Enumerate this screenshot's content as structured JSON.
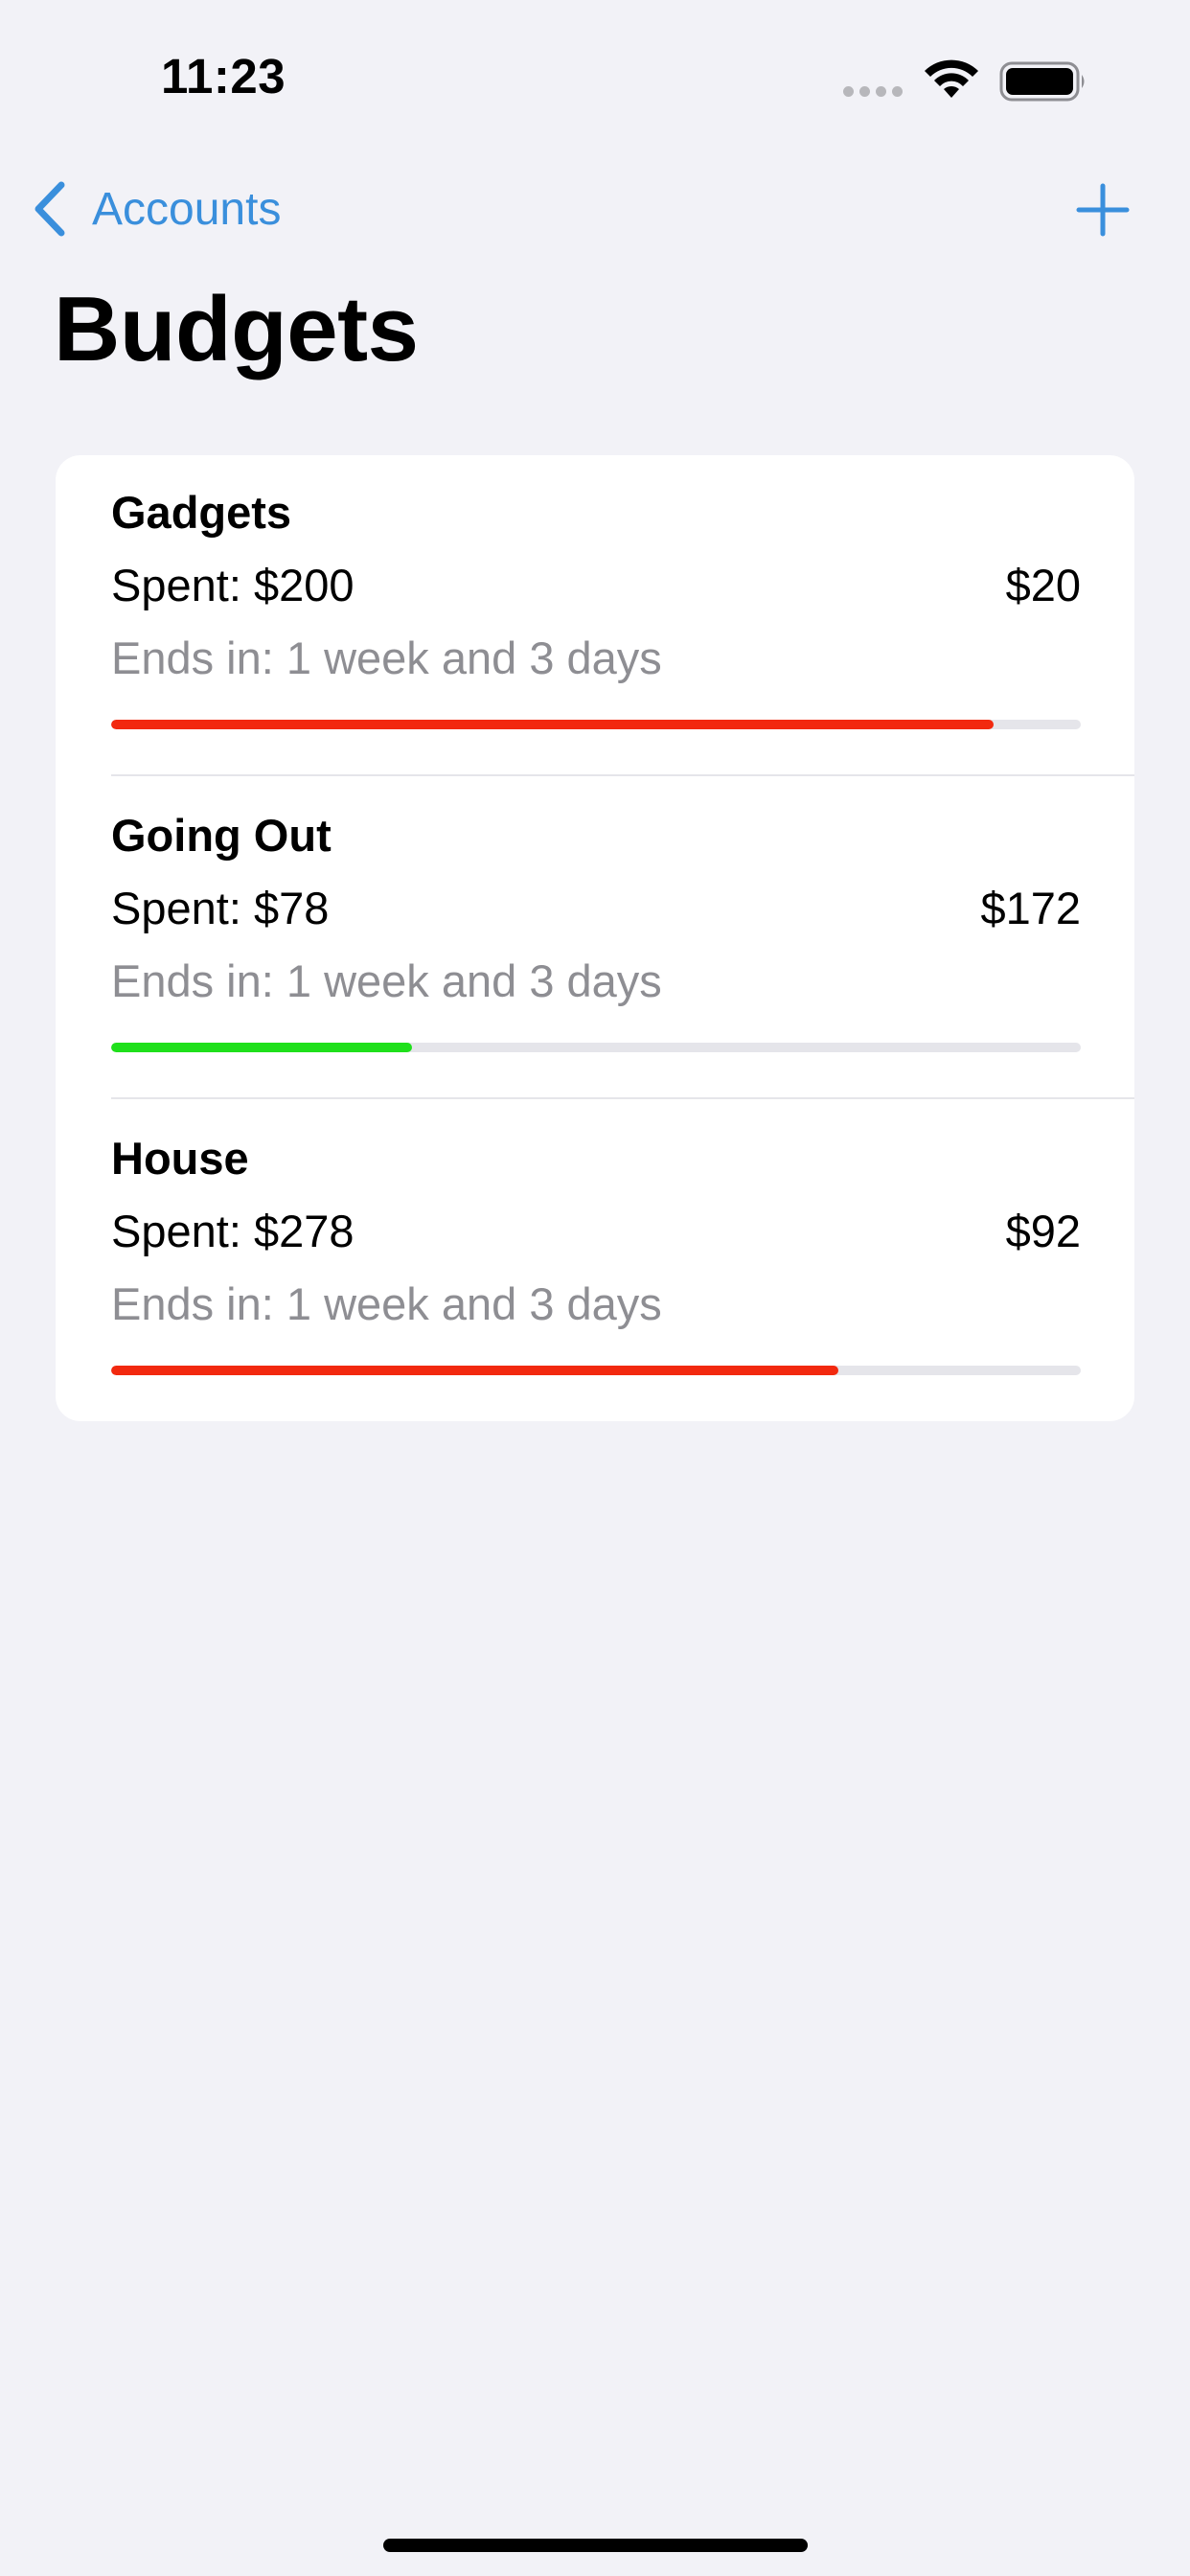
{
  "status_bar": {
    "time": "11:23"
  },
  "nav": {
    "back_label": "Accounts",
    "back_icon": "chevron-left-icon",
    "add_icon": "plus-icon",
    "accent_color": "#3a8fdc"
  },
  "page": {
    "title": "Budgets"
  },
  "budgets": [
    {
      "name": "Gadgets",
      "spent": "Spent: $200",
      "remaining": "$20",
      "ends": "Ends in: 1 week and 3 days",
      "progress": 0.91,
      "bar_color": "#f2290f"
    },
    {
      "name": "Going Out",
      "spent": "Spent: $78",
      "remaining": "$172",
      "ends": "Ends in: 1 week and 3 days",
      "progress": 0.31,
      "bar_color": "#1fe01b"
    },
    {
      "name": "House",
      "spent": "Spent: $278",
      "remaining": "$92",
      "ends": "Ends in: 1 week and 3 days",
      "progress": 0.75,
      "bar_color": "#f2290f"
    }
  ]
}
